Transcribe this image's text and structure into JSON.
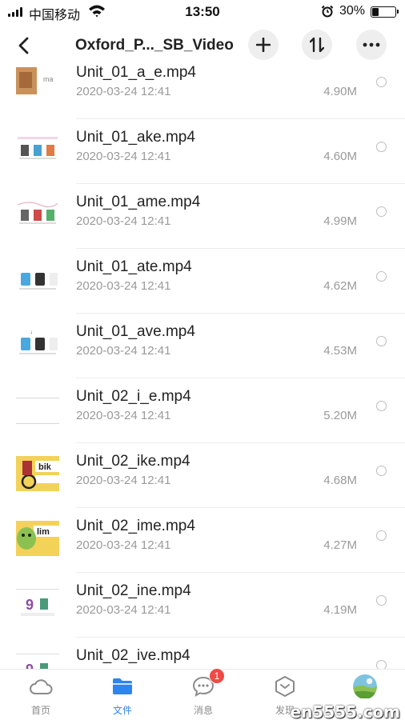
{
  "status_bar": {
    "carrier": "中国移动",
    "time": "13:50",
    "battery_percent": "30%",
    "battery_level": 0.3
  },
  "nav": {
    "title": "Oxford_P..._SB_Video",
    "icons": [
      "back-chevron-icon",
      "plus-icon",
      "sort-icon",
      "more-icon"
    ]
  },
  "files": [
    {
      "name": "Unit_01_a_e.mp4",
      "date": "2020-03-24 12:41",
      "size": "4.90M",
      "thumb": "a_e"
    },
    {
      "name": "Unit_01_ake.mp4",
      "date": "2020-03-24 12:41",
      "size": "4.60M",
      "thumb": "ake"
    },
    {
      "name": "Unit_01_ame.mp4",
      "date": "2020-03-24 12:41",
      "size": "4.99M",
      "thumb": "ame"
    },
    {
      "name": "Unit_01_ate.mp4",
      "date": "2020-03-24 12:41",
      "size": "4.62M",
      "thumb": "ate"
    },
    {
      "name": "Unit_01_ave.mp4",
      "date": "2020-03-24 12:41",
      "size": "4.53M",
      "thumb": "ave"
    },
    {
      "name": "Unit_02_i_e.mp4",
      "date": "2020-03-24 12:41",
      "size": "5.20M",
      "thumb": "i_e"
    },
    {
      "name": "Unit_02_ike.mp4",
      "date": "2020-03-24 12:41",
      "size": "4.68M",
      "thumb": "ike"
    },
    {
      "name": "Unit_02_ime.mp4",
      "date": "2020-03-24 12:41",
      "size": "4.27M",
      "thumb": "ime"
    },
    {
      "name": "Unit_02_ine.mp4",
      "date": "2020-03-24 12:41",
      "size": "4.19M",
      "thumb": "ine"
    },
    {
      "name": "Unit_02_ive.mp4",
      "date": "",
      "size": "",
      "thumb": "ive"
    }
  ],
  "tabbar": {
    "items": [
      {
        "label": "首页",
        "icon": "cloud-icon",
        "active": false
      },
      {
        "label": "文件",
        "icon": "folder-icon",
        "active": true
      },
      {
        "label": "消息",
        "icon": "chat-icon",
        "active": false,
        "badge": "1"
      },
      {
        "label": "发现",
        "icon": "discover-icon",
        "active": false
      },
      {
        "label": "",
        "icon": "avatar",
        "active": false
      }
    ]
  },
  "watermark": "en5555.com",
  "colors": {
    "accent": "#2f84f0",
    "badge": "#ee4b45",
    "secondary_text": "#9a9a9a"
  }
}
